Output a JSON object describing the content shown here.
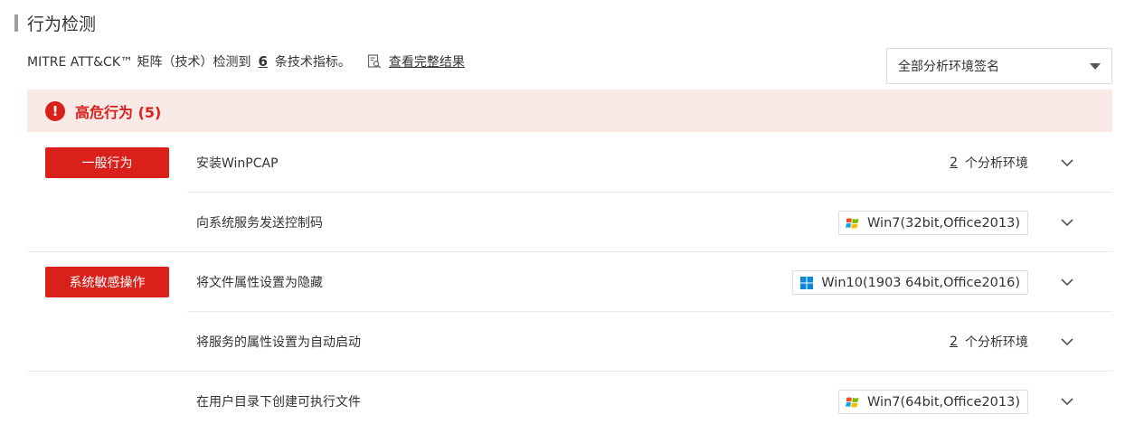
{
  "section": {
    "title": "行为检测"
  },
  "summary": {
    "prefix": "MITRE ATT&CK™ 矩阵（技术）检测到",
    "count": "6",
    "suffix": "条技术指标。",
    "link_label": "查看完整结果",
    "link_icon": "document-search-icon"
  },
  "env_filter": {
    "selected": "全部分析环境签名"
  },
  "group": {
    "icon": "alert-icon",
    "icon_char": "!",
    "label": "高危行为 (5)",
    "color": "#d9201b"
  },
  "rows": [
    {
      "tag": "一般行为",
      "name": "安装WinPCAP",
      "env_count": "2",
      "env_count_suffix": "个分析环境",
      "env": ""
    },
    {
      "tag": "",
      "name": "向系统服务发送控制码",
      "env_count": "",
      "env_count_suffix": "",
      "env": "Win7(32bit,Office2013)",
      "env_icon": "windows7-icon"
    },
    {
      "tag": "系统敏感操作",
      "name": "将文件属性设置为隐藏",
      "env_count": "",
      "env_count_suffix": "",
      "env": "Win10(1903 64bit,Office2016)",
      "env_icon": "windows10-icon"
    },
    {
      "tag": "",
      "name": "将服务的属性设置为自动启动",
      "env_count": "2",
      "env_count_suffix": "个分析环境",
      "env": ""
    },
    {
      "tag": "",
      "name": "在用户目录下创建可执行文件",
      "env_count": "",
      "env_count_suffix": "",
      "env": "Win7(64bit,Office2013)",
      "env_icon": "windows7-icon"
    }
  ]
}
